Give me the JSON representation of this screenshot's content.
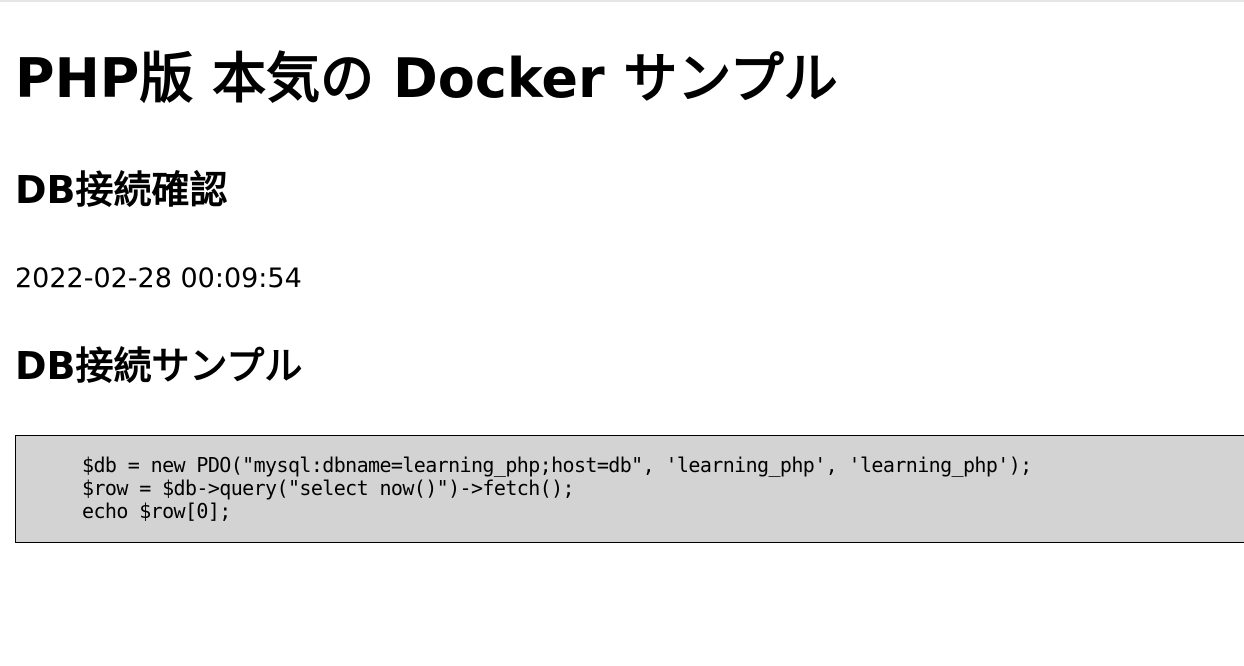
{
  "page": {
    "title": "PHP版 本気の Docker サンプル",
    "sections": [
      {
        "heading": "DB接続確認",
        "value": "2022-02-28 00:09:54"
      },
      {
        "heading": "DB接続サンプル"
      }
    ],
    "code": [
      "$db = new PDO(\"mysql:dbname=learning_php;host=db\", 'learning_php', 'learning_php');",
      "$row = $db->query(\"select now()\")->fetch();",
      "echo $row[0];"
    ]
  },
  "colors": {
    "background": "#ffffff",
    "code_background": "#d3d3d3",
    "code_border": "#000000",
    "text": "#000000"
  }
}
